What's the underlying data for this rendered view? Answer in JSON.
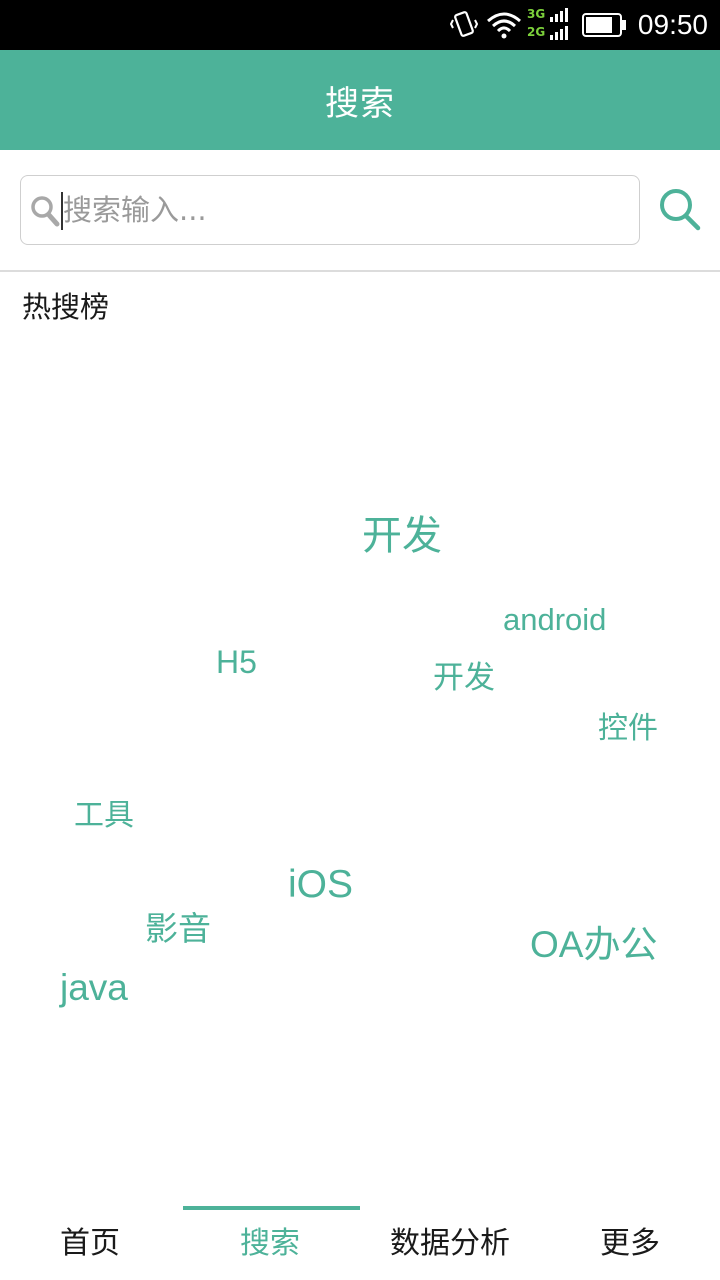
{
  "status_bar": {
    "time": "09:50",
    "network_top": "3G",
    "network_bottom": "2G",
    "icons": [
      "vibrate-icon",
      "wifi-icon",
      "signal-icon",
      "battery-icon"
    ]
  },
  "app_bar": {
    "title": "搜索"
  },
  "search": {
    "placeholder": "搜索输入..."
  },
  "hot_section": {
    "title": "热搜榜"
  },
  "tags": [
    {
      "label": "开发"
    },
    {
      "label": "android"
    },
    {
      "label": "H5"
    },
    {
      "label": "开发"
    },
    {
      "label": "控件"
    },
    {
      "label": "工具"
    },
    {
      "label": "iOS"
    },
    {
      "label": "影音"
    },
    {
      "label": "OA办公"
    },
    {
      "label": "java"
    }
  ],
  "bottom_nav": {
    "items": [
      {
        "label": "首页"
      },
      {
        "label": "搜索"
      },
      {
        "label": "数据分析"
      },
      {
        "label": "更多"
      }
    ],
    "active": "搜索"
  },
  "colors": {
    "accent": "#4db299",
    "status_bar": "#000000",
    "text": "#1a1a1a",
    "hint": "#9a9a9a"
  }
}
